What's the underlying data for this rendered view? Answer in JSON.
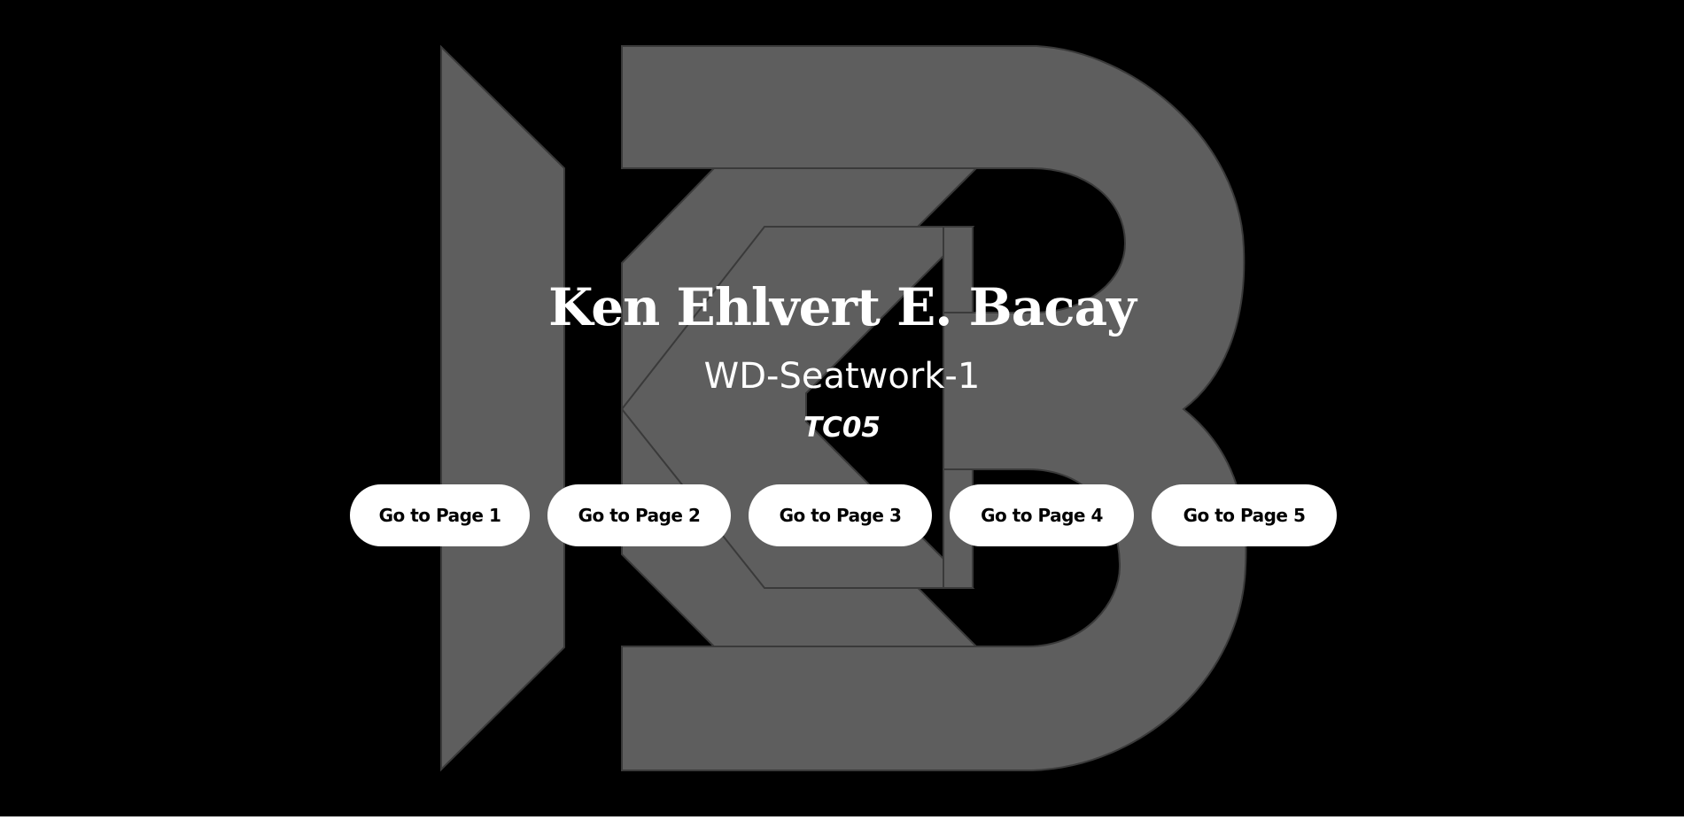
{
  "header": {
    "name": "Ken Ehlvert E. Bacay",
    "subtitle": "WD-Seatwork-1",
    "section": "TC05"
  },
  "logo": {
    "icon": "kb-monogram-logo",
    "color": "#5e5e5e"
  },
  "nav": {
    "buttons": [
      {
        "label": "Go to Page 1"
      },
      {
        "label": "Go to Page 2"
      },
      {
        "label": "Go to Page 3"
      },
      {
        "label": "Go to Page 4"
      },
      {
        "label": "Go to Page 5"
      }
    ]
  },
  "colors": {
    "background": "#000000",
    "text": "#ffffff",
    "button_bg": "#ffffff",
    "button_text": "#000000"
  }
}
